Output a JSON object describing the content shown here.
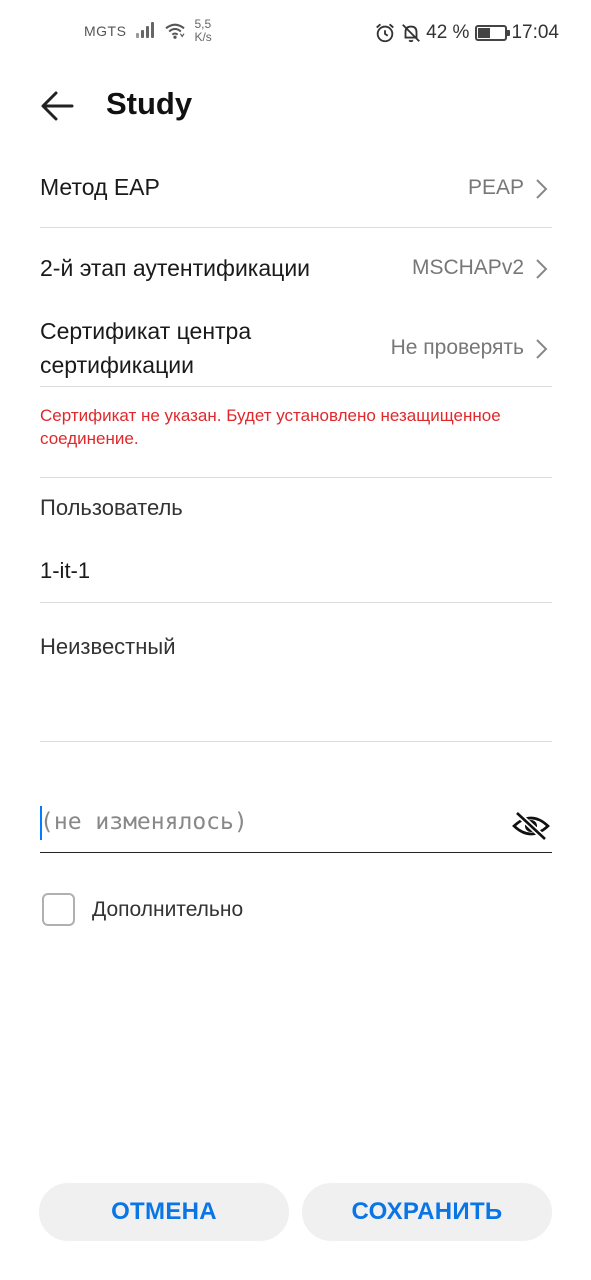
{
  "status_bar": {
    "carrier": "MGTS",
    "speed_value": "5,5",
    "speed_unit": "K/s",
    "battery_percent": "42 %",
    "battery_level": 0.42,
    "time": "17:04"
  },
  "header": {
    "title": "Study"
  },
  "settings": {
    "eap_method": {
      "label": "Метод EAP",
      "value": "PEAP"
    },
    "phase2_auth": {
      "label": "2-й этап аутентификации",
      "value": "MSCHAPv2"
    },
    "ca_cert": {
      "label_line1": "Сертификат центра",
      "label_line2": "сертификации",
      "value": "Не проверять"
    },
    "warning": "Сертификат не указан. Будет установлено незащищенное соединение."
  },
  "identity": {
    "label": "Пользователь",
    "value": "1-it-1"
  },
  "anonymous": {
    "label": "Неизвестный",
    "value": ""
  },
  "password": {
    "placeholder": "(не изменялось)"
  },
  "advanced": {
    "label": "Дополнительно",
    "checked": false
  },
  "buttons": {
    "cancel": "ОТМЕНА",
    "save": "СОХРАНИТЬ"
  },
  "colors": {
    "accent": "#0a75e6",
    "error": "#e0282c",
    "cursor": "#007dff"
  },
  "icons": [
    "signal-icon",
    "wifi-icon",
    "alarm-icon",
    "bell-off-icon",
    "battery-icon",
    "back-arrow-icon",
    "chevron-right-icon",
    "eye-off-icon"
  ]
}
